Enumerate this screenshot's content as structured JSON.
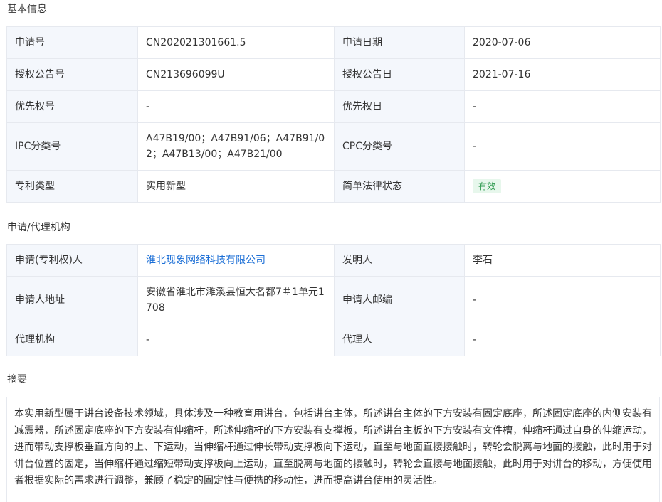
{
  "basic": {
    "title": "基本信息",
    "rows": [
      {
        "l1": "申请号",
        "v1": "CN202021301661.5",
        "l2": "申请日期",
        "v2": "2020-07-06"
      },
      {
        "l1": "授权公告号",
        "v1": "CN213696099U",
        "l2": "授权公告日",
        "v2": "2021-07-16"
      },
      {
        "l1": "优先权号",
        "v1": "-",
        "l2": "优先权日",
        "v2": "-"
      },
      {
        "l1": "IPC分类号",
        "v1": "A47B19/00；A47B91/06；A47B91/02；A47B13/00；A47B21/00",
        "l2": "CPC分类号",
        "v2": "-"
      },
      {
        "l1": "专利类型",
        "v1": "实用新型",
        "l2": "简单法律状态",
        "v2": "有效"
      }
    ]
  },
  "agency": {
    "title": "申请/代理机构",
    "rows": [
      {
        "l1": "申请(专利权)人",
        "v1": "淮北现象网络科技有限公司",
        "l2": "发明人",
        "v2": "李石"
      },
      {
        "l1": "申请人地址",
        "v1": "安徽省淮北市濉溪县恒大名都7＃1单元1708",
        "l2": "申请人邮编",
        "v2": "-"
      },
      {
        "l1": "代理机构",
        "v1": "-",
        "l2": "代理人",
        "v2": "-"
      }
    ]
  },
  "abstract": {
    "title": "摘要",
    "text": "本实用新型属于讲台设备技术领域，具体涉及一种教育用讲台，包括讲台主体，所述讲台主体的下方安装有固定底座，所述固定底座的内侧安装有减震器，所述固定底座的下方安装有伸缩杆，所述伸缩杆的下方安装有支撑板，所述讲台主板的下方安装有文件槽，伸缩杆通过自身的伸缩运动，进而带动支撑板垂直方向的上、下运动，当伸缩杆通过伸长带动支撑板向下运动，直至与地面直接接触时，转轮会脱离与地面的接触，此时用于对讲台位置的固定，当伸缩杆通过缩短带动支撑板向上运动，直至脱离与地面的接触时，转轮会直接与地面接触，此时用于对讲台的移动，方便使用者根据实际的需求进行调整，兼顾了稳定的固定性与便携的移动性，进而提高讲台使用的灵活性。"
  },
  "colors": {
    "label_bg": "#f4f7fc",
    "border": "#e6e9ef",
    "link": "#1c6fd6",
    "status_bg": "#e7f7ec",
    "status_text": "#2e9a4f"
  }
}
